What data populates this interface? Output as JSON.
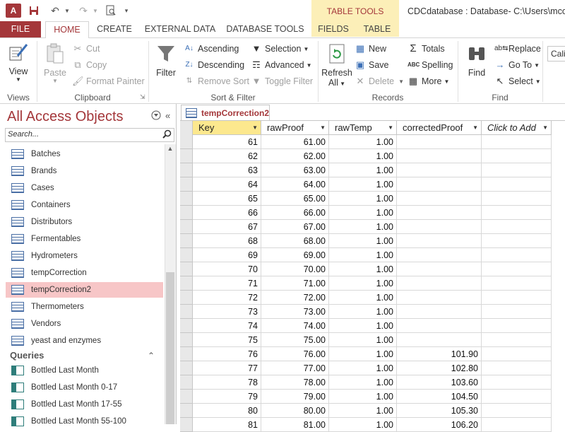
{
  "app": {
    "logo": "A",
    "window_title": "CDCdatabase : Database- C:\\Users\\mcothe",
    "contextual_group": "TABLE TOOLS"
  },
  "quick_access": {
    "save_icon": "save-icon",
    "undo_icon": "undo-icon",
    "redo_icon": "redo-icon",
    "print_preview_icon": "print-preview-icon",
    "customize_icon": "customize-icon"
  },
  "tabs": [
    "FILE",
    "HOME",
    "CREATE",
    "EXTERNAL DATA",
    "DATABASE TOOLS",
    "FIELDS",
    "TABLE"
  ],
  "ribbon": {
    "views": {
      "label": "Views",
      "view": "View"
    },
    "clipboard": {
      "label": "Clipboard",
      "paste": "Paste",
      "cut": "Cut",
      "copy": "Copy",
      "format_painter": "Format Painter"
    },
    "sort_filter": {
      "label": "Sort & Filter",
      "filter": "Filter",
      "ascending": "Ascending",
      "descending": "Descending",
      "remove_sort": "Remove Sort",
      "selection": "Selection",
      "advanced": "Advanced",
      "toggle_filter": "Toggle Filter"
    },
    "records": {
      "label": "Records",
      "refresh": "Refresh",
      "refresh_all": "All",
      "new": "New",
      "save": "Save",
      "delete": "Delete",
      "totals": "Totals",
      "spelling": "Spelling",
      "more": "More"
    },
    "find": {
      "label": "Find",
      "find": "Find",
      "replace": "Replace",
      "goto": "Go To",
      "select": "Select"
    },
    "font": {
      "name": "Calil"
    }
  },
  "nav": {
    "title": "All Access Objects",
    "search_placeholder": "Search...",
    "tables": [
      "Batches",
      "Brands",
      "Cases",
      "Containers",
      "Distributors",
      "Fermentables",
      "Hydrometers",
      "tempCorrection",
      "tempCorrection2",
      "Thermometers",
      "Vendors",
      "yeast and enzymes"
    ],
    "selected_index": 8,
    "queries_label": "Queries",
    "queries": [
      "Bottled Last Month",
      "Bottled Last Month 0-17",
      "Bottled Last Month 17-55",
      "Bottled Last Month 55-100"
    ]
  },
  "document": {
    "tab_label": "tempCorrection2",
    "columns": [
      "Key",
      "rawProof",
      "rawTemp",
      "correctedProof",
      "Click to Add"
    ],
    "rows": [
      [
        "61",
        "61.00",
        "1.00",
        ""
      ],
      [
        "62",
        "62.00",
        "1.00",
        ""
      ],
      [
        "63",
        "63.00",
        "1.00",
        ""
      ],
      [
        "64",
        "64.00",
        "1.00",
        ""
      ],
      [
        "65",
        "65.00",
        "1.00",
        ""
      ],
      [
        "66",
        "66.00",
        "1.00",
        ""
      ],
      [
        "67",
        "67.00",
        "1.00",
        ""
      ],
      [
        "68",
        "68.00",
        "1.00",
        ""
      ],
      [
        "69",
        "69.00",
        "1.00",
        ""
      ],
      [
        "70",
        "70.00",
        "1.00",
        ""
      ],
      [
        "71",
        "71.00",
        "1.00",
        ""
      ],
      [
        "72",
        "72.00",
        "1.00",
        ""
      ],
      [
        "73",
        "73.00",
        "1.00",
        ""
      ],
      [
        "74",
        "74.00",
        "1.00",
        ""
      ],
      [
        "75",
        "75.00",
        "1.00",
        ""
      ],
      [
        "76",
        "76.00",
        "1.00",
        "101.90"
      ],
      [
        "77",
        "77.00",
        "1.00",
        "102.80"
      ],
      [
        "78",
        "78.00",
        "1.00",
        "103.60"
      ],
      [
        "79",
        "79.00",
        "1.00",
        "104.50"
      ],
      [
        "80",
        "80.00",
        "1.00",
        "105.30"
      ],
      [
        "81",
        "81.00",
        "1.00",
        "106.20"
      ]
    ]
  },
  "colors": {
    "accent": "#a4373a",
    "key_header": "#fce88e",
    "selected": "#f7c6c7",
    "table_tools": "#fcefb8"
  }
}
